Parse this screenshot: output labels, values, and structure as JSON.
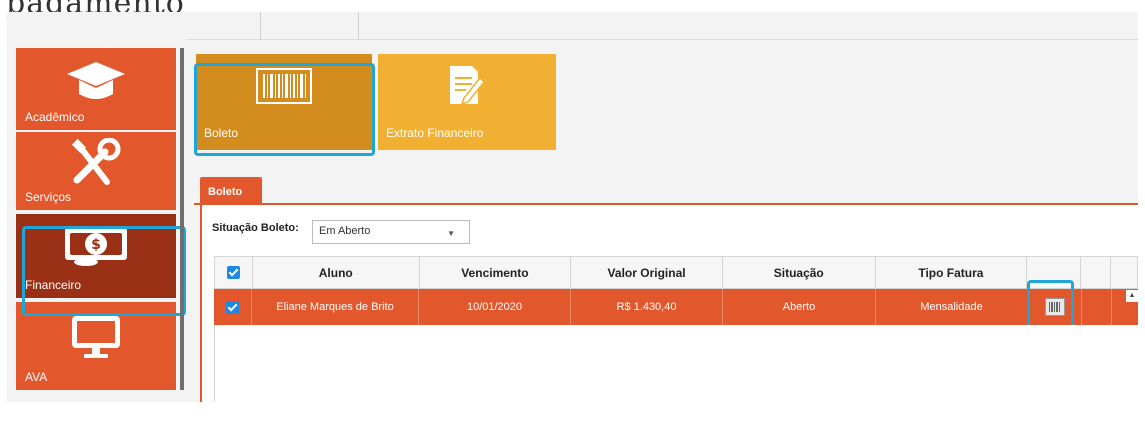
{
  "caption": "pagamento",
  "sidebar": {
    "items": [
      {
        "label": "Acadêmico",
        "icon": "graduation-cap-icon"
      },
      {
        "label": "Serviços",
        "icon": "tools-icon"
      },
      {
        "label": "Financeiro",
        "icon": "money-icon"
      },
      {
        "label": "AVA",
        "icon": "monitor-icon"
      }
    ]
  },
  "toolbar": {
    "tiles": [
      {
        "label": "Boleto",
        "icon": "barcode-icon"
      },
      {
        "label": "Extrato Financeiro",
        "icon": "document-edit-icon"
      }
    ]
  },
  "tab": {
    "label": "Boleto"
  },
  "filter": {
    "label": "Situação Boleto:",
    "value": "Em Aberto"
  },
  "table": {
    "headers": [
      "Aluno",
      "Vencimento",
      "Valor Original",
      "Situação",
      "Tipo Fatura"
    ],
    "rows": [
      {
        "aluno": "Eliane Marques de Brito",
        "vencimento": "10/01/2020",
        "valor": "R$ 1.430,40",
        "situacao": "Aberto",
        "tipo": "Mensalidade"
      }
    ]
  },
  "colors": {
    "accent": "#e2572c",
    "selected_nav": "#9a3016",
    "tile_boleto": "#d38d1f",
    "tile_extrato": "#f2b033",
    "highlight": "#1fa6d8"
  }
}
